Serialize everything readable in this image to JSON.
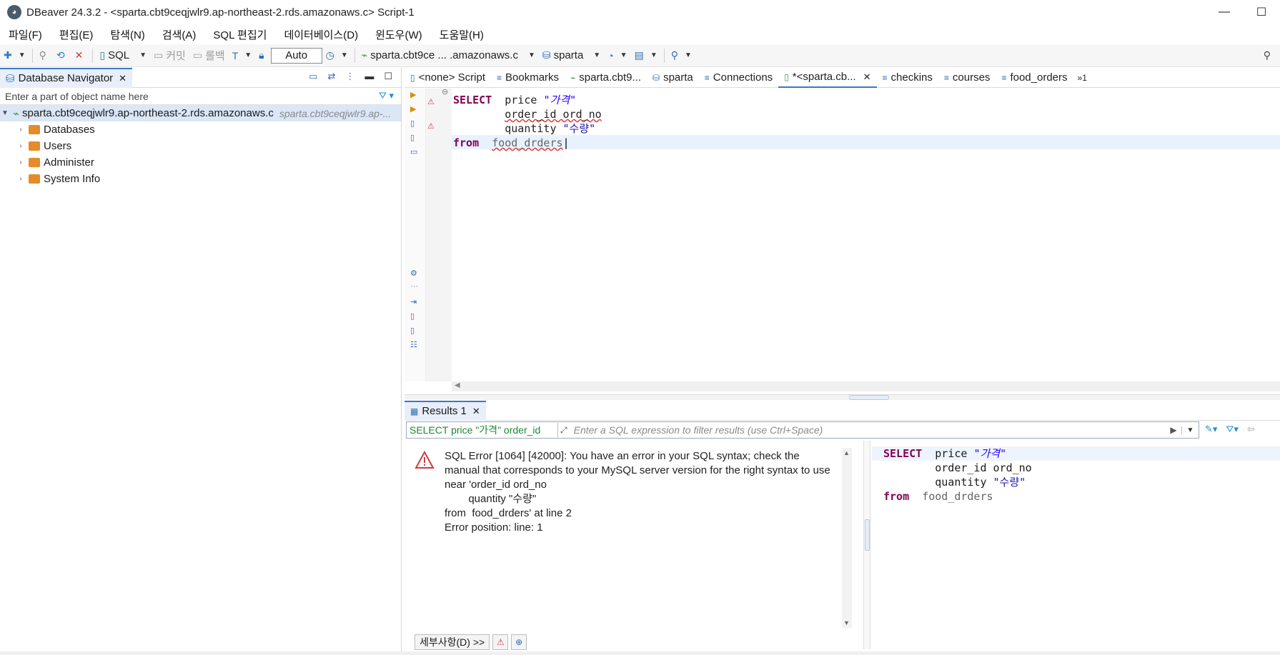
{
  "window": {
    "title": "DBeaver 24.3.2 - <sparta.cbt9ceqjwlr9.ap-northeast-2.rds.amazonaws.c> Script-1",
    "minimize": "—",
    "maximize": "☐"
  },
  "menu": [
    "파일(F)",
    "편집(E)",
    "탐색(N)",
    "검색(A)",
    "SQL 편집기",
    "데이터베이스(D)",
    "윈도우(W)",
    "도움말(H)"
  ],
  "toolbar": {
    "sql_label": "SQL",
    "commit_label": "커밋",
    "rollback_label": "롤백",
    "auto_label": "Auto",
    "connection_label": "sparta.cbt9ce ... .amazonaws.c",
    "schema_label": "sparta"
  },
  "navigator": {
    "tab_label": "Database Navigator",
    "search_placeholder": "Enter a part of object name here",
    "root_label": "sparta.cbt9ceqjwlr9.ap-northeast-2.rds.amazonaws.c",
    "root_hint": "sparta.cbt9ceqjwlr9.ap-...",
    "items": [
      "Databases",
      "Users",
      "Administer",
      "System Info"
    ]
  },
  "editor_tabs": [
    "<none> Script",
    "Bookmarks",
    "sparta.cbt9...",
    "sparta",
    "Connections",
    "*<sparta.cb...",
    "checkins",
    "courses",
    "food_orders"
  ],
  "tab_overflow": "»1",
  "editor": {
    "kw_select": "SELECT",
    "col1": "price",
    "alias1": "\"가격\"",
    "col2": "order_id ord_no",
    "col3": "quantity",
    "alias3": "\"수량\"",
    "kw_from": "from",
    "table": "food_drders"
  },
  "results": {
    "tab_label": "Results 1",
    "query_chip": "SELECT price \"가격\" order_id",
    "filter_placeholder": "Enter a SQL expression to filter results (use Ctrl+Space)",
    "error_message": "SQL Error [1064] [42000]: You have an error in your SQL syntax; check the manual that corresponds to your MySQL server version for the right syntax to use near 'order_id ord_no\n        quantity \"수량\"\nfrom  food_drders' at line 2\nError position: line: 1",
    "details_button": "세부사항(D) >>"
  },
  "colors": {
    "accent": "#3c78c3",
    "keyword": "#7f0055",
    "error": "#d13b3b",
    "query_chip": "#1c8a2d"
  }
}
